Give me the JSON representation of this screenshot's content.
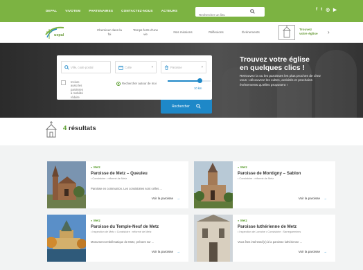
{
  "topbar": {
    "links": [
      "DEPAL",
      "VIVOTEM",
      "PARTENAIRES",
      "CONTACTEZ-NOUS",
      "ACTEURS"
    ],
    "search_placeholder": "Rechercher un lieu",
    "social": [
      "f",
      "t",
      "◎",
      "▶"
    ]
  },
  "nav": {
    "logo_text": "uepal",
    "items": [
      {
        "label": "Cheminer dans la foi"
      },
      {
        "label": "Temps forts d'une vie"
      },
      {
        "label": "Nos missions"
      },
      {
        "label": "Réflexions"
      },
      {
        "label": "Événements"
      }
    ],
    "locator": {
      "label1": "Trouvez",
      "label2": "votre église"
    }
  },
  "hero": {
    "title_line1": "Trouvez votre église",
    "title_line2": "en quelques clics !",
    "description": "Retrouvez la ou les paroisses les plus proches de chez vous : découvrez les cultes, activités et prochains événements qu'elles proposent !"
  },
  "search": {
    "location_placeholder": "Ville, code postal",
    "field2": "Culte",
    "field3": "Paroisse",
    "checkbox_label_1": "Inclure aussi les paroisses",
    "checkbox_label_2": "à mobilité réduite",
    "radio_label": "Rechercher autour de moi",
    "slider_value": "10 km",
    "slider_fraction": 0.75,
    "button_label": "Rechercher"
  },
  "results": {
    "count": "4",
    "label": "résultats"
  },
  "cards": [
    {
      "tag": "Metz",
      "title": "Paroisse de Metz – Queuleu",
      "meta": "• Consistoire : réformé de Metz",
      "desc": "Paroisse en communion. Les consistoires sont celles ...",
      "link": "Voir la paroisse"
    },
    {
      "tag": "Metz",
      "title": "Paroisse de Montigny – Sablon",
      "meta": "• Consistoire : réformé de Metz",
      "desc": "",
      "link": "Voir la paroisse"
    },
    {
      "tag": "Metz",
      "title": "Paroisse du Temple-Neuf de Metz",
      "meta": "• Inspection de Metz   • Consistoire : réformé de Metz",
      "desc": "Monument emblématique de Metz, présent sur ...",
      "link": "Voir la paroisse"
    },
    {
      "tag": "Metz",
      "title": "Paroisse luthérienne de Metz",
      "meta": "• Inspection de Lorraine   • Consistoire : Sarreguemines",
      "desc": "Vous êtes intéressé(e) à la paroisse luthérienne ...",
      "link": "Voir la paroisse"
    }
  ],
  "colors": {
    "brand_green": "#7cb342",
    "accent_blue": "#1e88c8",
    "dark_text": "#333333"
  }
}
